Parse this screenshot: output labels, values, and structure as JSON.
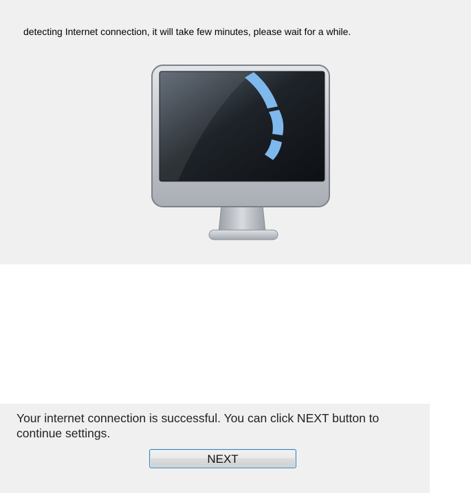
{
  "detect": {
    "message": "detecting Internet connection, it will take few minutes, please wait for a while."
  },
  "monitor": {
    "icon": "monitor-icon",
    "spinner_icon": "loading-spinner-icon",
    "spinner_color": "#7fb8ec"
  },
  "result": {
    "message": "Your internet connection is successful. You can click NEXT button to continue settings.",
    "next_label": "NEXT"
  }
}
